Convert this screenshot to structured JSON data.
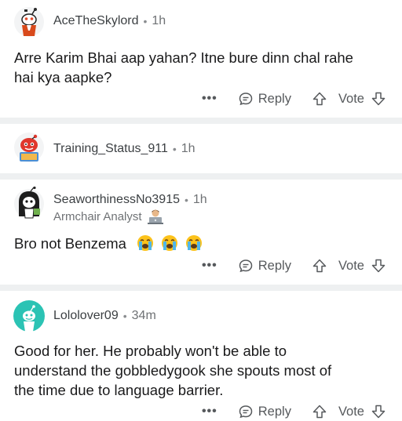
{
  "comments": [
    {
      "username": "AceTheSkylord",
      "time": "1h",
      "text_lines": [
        "Arre Karim Bhai aap yahan? Itne bure dinn chal rahe",
        "hai kya aapke?"
      ],
      "actions": {
        "more": "•••",
        "reply": "Reply",
        "vote": "Vote"
      }
    },
    {
      "username": "Training_Status_911",
      "time": "1h"
    },
    {
      "username": "SeaworthinessNo3915",
      "time": "1h",
      "flair": "Armchair Analyst",
      "text": "Bro not Benzema",
      "emojis": [
        "crying-face",
        "crying-face",
        "crying-face"
      ],
      "actions": {
        "more": "•••",
        "reply": "Reply",
        "vote": "Vote"
      }
    },
    {
      "username": "Lololover09",
      "time": "34m",
      "text_lines": [
        "Good for her. He probably won't be able to",
        "understand the gobbledygook she spouts most of",
        "the time due to language barrier."
      ],
      "actions": {
        "more": "•••",
        "reply": "Reply",
        "vote": "Vote"
      }
    }
  ],
  "separator": "•",
  "colors": {
    "separator": "#eef0f1",
    "meta_text": "#6f7275",
    "body_text": "#1a1a1b",
    "avatar_teal": "#2bc3b4"
  }
}
